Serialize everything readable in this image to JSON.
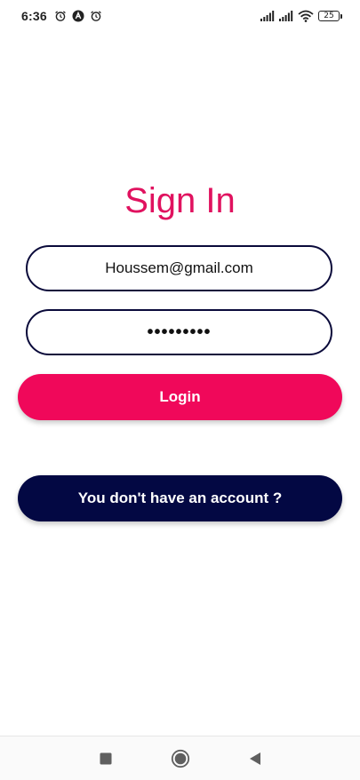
{
  "status_bar": {
    "time": "6:36",
    "battery": "25"
  },
  "signin": {
    "title": "Sign In",
    "email_value": "Houssem@gmail.com",
    "password_value": "•••••••••",
    "login_label": "Login",
    "no_account_label": "You don't have an account ?"
  },
  "colors": {
    "accent_pink": "#f0085a",
    "title_pink": "#e0125f",
    "navy": "#030843",
    "field_border": "#0a0a3a"
  },
  "icons": {
    "status_left": [
      "alarm-icon",
      "app-notification-icon",
      "alarm-icon"
    ],
    "status_right": [
      "signal-icon",
      "signal-icon",
      "wifi-icon",
      "battery-icon"
    ],
    "nav": [
      "recent-apps-icon",
      "home-icon",
      "back-icon"
    ]
  }
}
